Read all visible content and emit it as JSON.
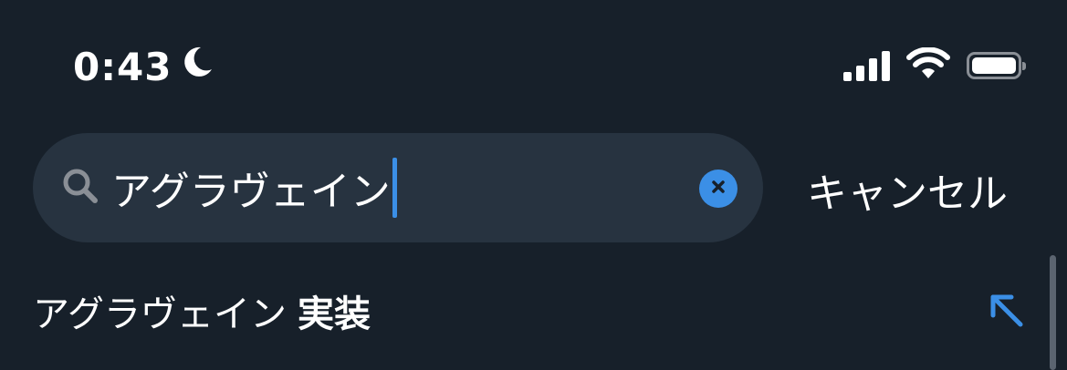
{
  "status_bar": {
    "time": "0:43",
    "icons": [
      "moon-icon",
      "cellular-signal-icon",
      "wifi-icon",
      "battery-icon"
    ]
  },
  "search": {
    "query": "アグラヴェイン",
    "clear_icon": "clear-icon",
    "search_icon": "search-icon",
    "cancel_label": "キャンセル"
  },
  "suggestions": [
    {
      "base": "アグラヴェイン",
      "completion": "実装",
      "icon": "fill-arrow-icon"
    }
  ],
  "colors": {
    "background": "#17202a",
    "search_field": "#273340",
    "accent": "#3b8fe6",
    "text": "#ffffff",
    "muted": "#8a8f96"
  }
}
